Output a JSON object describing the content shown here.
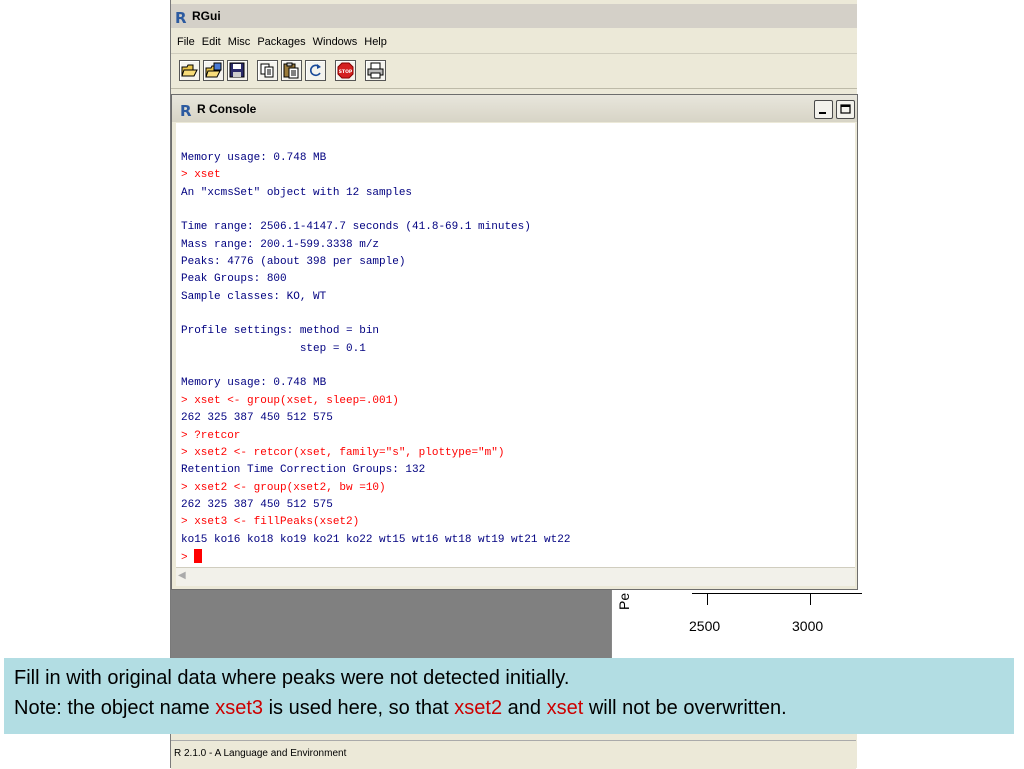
{
  "app": {
    "title": "RGui"
  },
  "menu": [
    "File",
    "Edit",
    "Misc",
    "Packages",
    "Windows",
    "Help"
  ],
  "toolbar": {
    "icons": [
      "open-script-icon",
      "load-workspace-icon",
      "save-icon",
      "copy-icon",
      "paste-icon",
      "refresh-icon",
      "stop-icon",
      "print-icon"
    ],
    "stop_label": "STOP"
  },
  "console": {
    "title": "R Console",
    "lines": [
      {
        "type": "out",
        "text": "Memory usage: 0.748 MB"
      },
      {
        "type": "cmd",
        "text": "> xset"
      },
      {
        "type": "out",
        "text": "An \"xcmsSet\" object with 12 samples"
      },
      {
        "type": "out",
        "text": ""
      },
      {
        "type": "out",
        "text": "Time range: 2506.1-4147.7 seconds (41.8-69.1 minutes)"
      },
      {
        "type": "out",
        "text": "Mass range: 200.1-599.3338 m/z"
      },
      {
        "type": "out",
        "text": "Peaks: 4776 (about 398 per sample)"
      },
      {
        "type": "out",
        "text": "Peak Groups: 800"
      },
      {
        "type": "out",
        "text": "Sample classes: KO, WT"
      },
      {
        "type": "out",
        "text": ""
      },
      {
        "type": "out",
        "text": "Profile settings: method = bin"
      },
      {
        "type": "out",
        "text": "                  step = 0.1"
      },
      {
        "type": "out",
        "text": ""
      },
      {
        "type": "out",
        "text": "Memory usage: 0.748 MB"
      },
      {
        "type": "cmd",
        "text": "> xset <- group(xset, sleep=.001)"
      },
      {
        "type": "out",
        "text": "262 325 387 450 512 575"
      },
      {
        "type": "cmd",
        "text": "> ?retcor"
      },
      {
        "type": "cmd",
        "text": "> xset2 <- retcor(xset, family=\"s\", plottype=\"m\")"
      },
      {
        "type": "out",
        "text": "Retention Time Correction Groups: 132"
      },
      {
        "type": "cmd",
        "text": "> xset2 <- group(xset2, bw =10)"
      },
      {
        "type": "out",
        "text": "262 325 387 450 512 575"
      },
      {
        "type": "cmd",
        "text": "> xset3 <- fillPeaks(xset2)"
      },
      {
        "type": "out",
        "text": "ko15 ko16 ko18 ko19 ko21 ko22 wt15 wt16 wt18 wt19 wt21 wt22"
      }
    ],
    "prompt": "> "
  },
  "plot": {
    "ylabel_fragment": "Pe",
    "ticks": [
      "2500",
      "3000"
    ]
  },
  "statusbar": {
    "text": "R 2.1.0 - A Language and Environment"
  },
  "callout": {
    "line1": "Fill in with original data where peaks were not detected initially.",
    "line2": {
      "p1": "Note: the object name ",
      "h1": "xset3",
      "p2": " is used here, so that ",
      "h2": "xset2",
      "p3": " and ",
      "h3": "xset",
      "p4": " will not be overwritten."
    },
    "highlight_color": "#cc0000",
    "background_color": "#b2dde3"
  },
  "colors": {
    "output_text": "#000080",
    "command_text": "#ff0000",
    "r_logo": "#2c5aa0"
  }
}
